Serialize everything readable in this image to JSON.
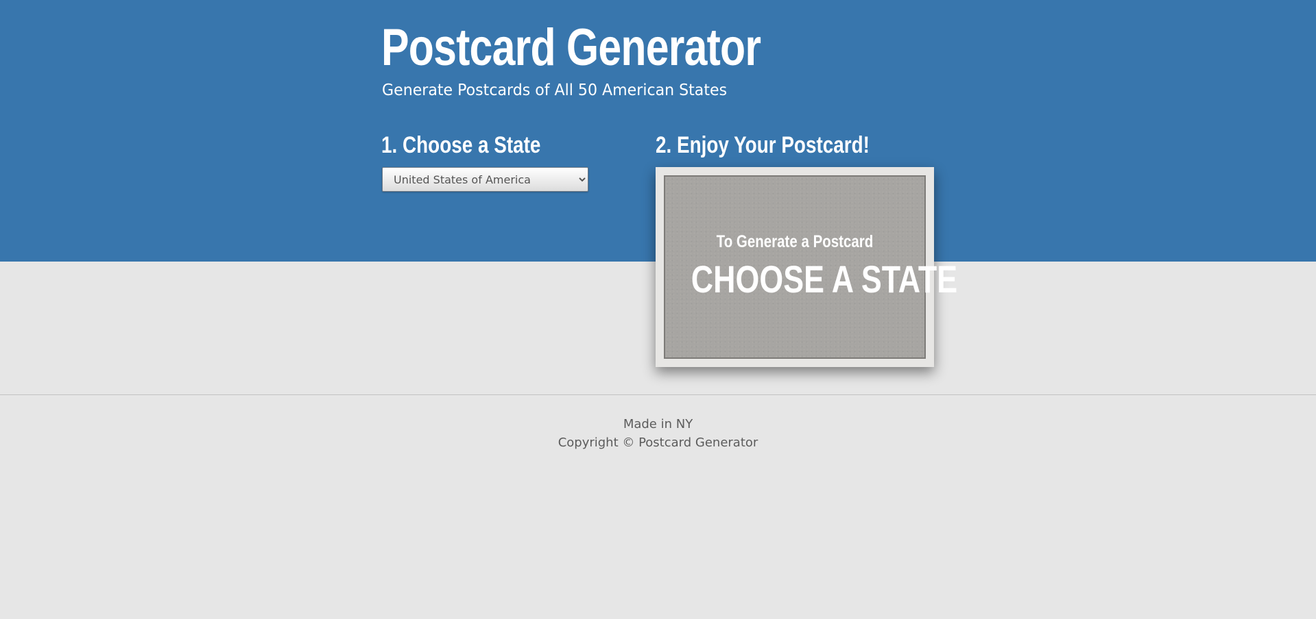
{
  "header": {
    "title": "Postcard Generator",
    "subtitle": "Generate Postcards of All 50 American States"
  },
  "steps": {
    "choose_heading": "1. Choose a State",
    "enjoy_heading": "2. Enjoy Your Postcard!"
  },
  "state_select": {
    "selected_value": "United States of America",
    "icon": "chevron-down-icon"
  },
  "postcard": {
    "line1": "To Generate a Postcard",
    "line2": "CHOOSE A STATE"
  },
  "footer": {
    "made_in": "Made in NY",
    "copyright": "Copyright © Postcard Generator"
  },
  "colors": {
    "header_bg": "#3876ad",
    "page_bg": "#e6e6e6",
    "postcard_face": "#a7a5a2",
    "text_light": "#ffffff"
  }
}
